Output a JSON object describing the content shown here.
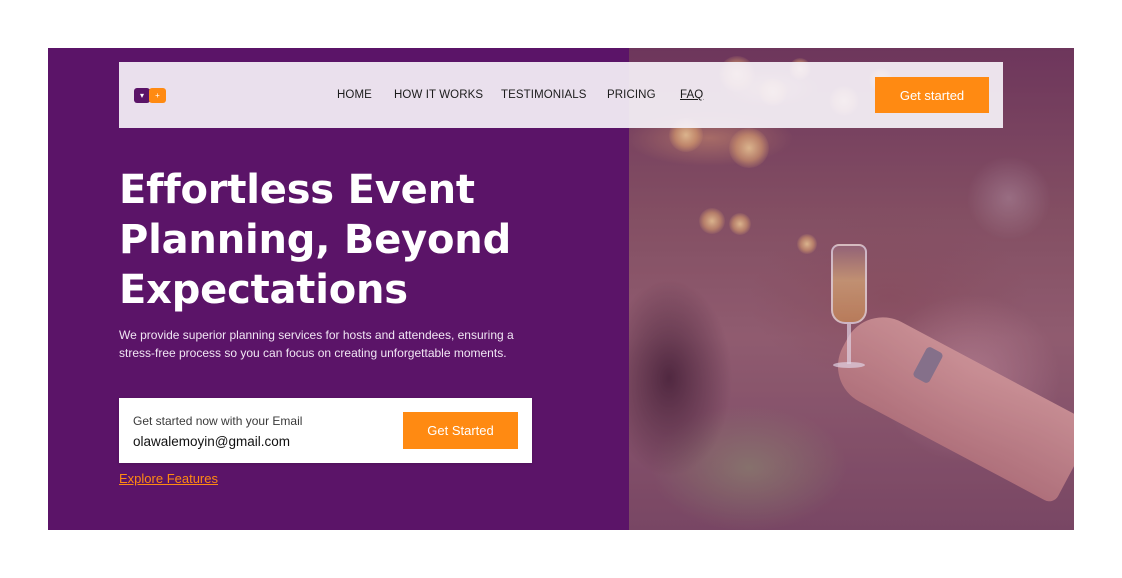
{
  "brand": {
    "logo_glyph_left": "▾",
    "logo_glyph_right": "+",
    "primary_color": "#5b1468",
    "accent_color": "#ff8a12"
  },
  "nav": {
    "items": [
      "HOME",
      "HOW IT WORKS",
      "TESTIMONIALS",
      "PRICING",
      "FAQ"
    ],
    "cta_label": "Get started"
  },
  "hero": {
    "title": "Effortless Event Planning, Beyond Expectations",
    "subtitle": "We provide superior planning services for hosts and attendees, ensuring a stress-free process so you can focus on creating unforgettable moments."
  },
  "email_form": {
    "label": "Get started now with your Email",
    "value": "olawalemoyin@gmail.com",
    "submit_label": "Get Started"
  },
  "explore_link": "Explore Features",
  "photo": {
    "icon": "event-celebration-photo"
  }
}
